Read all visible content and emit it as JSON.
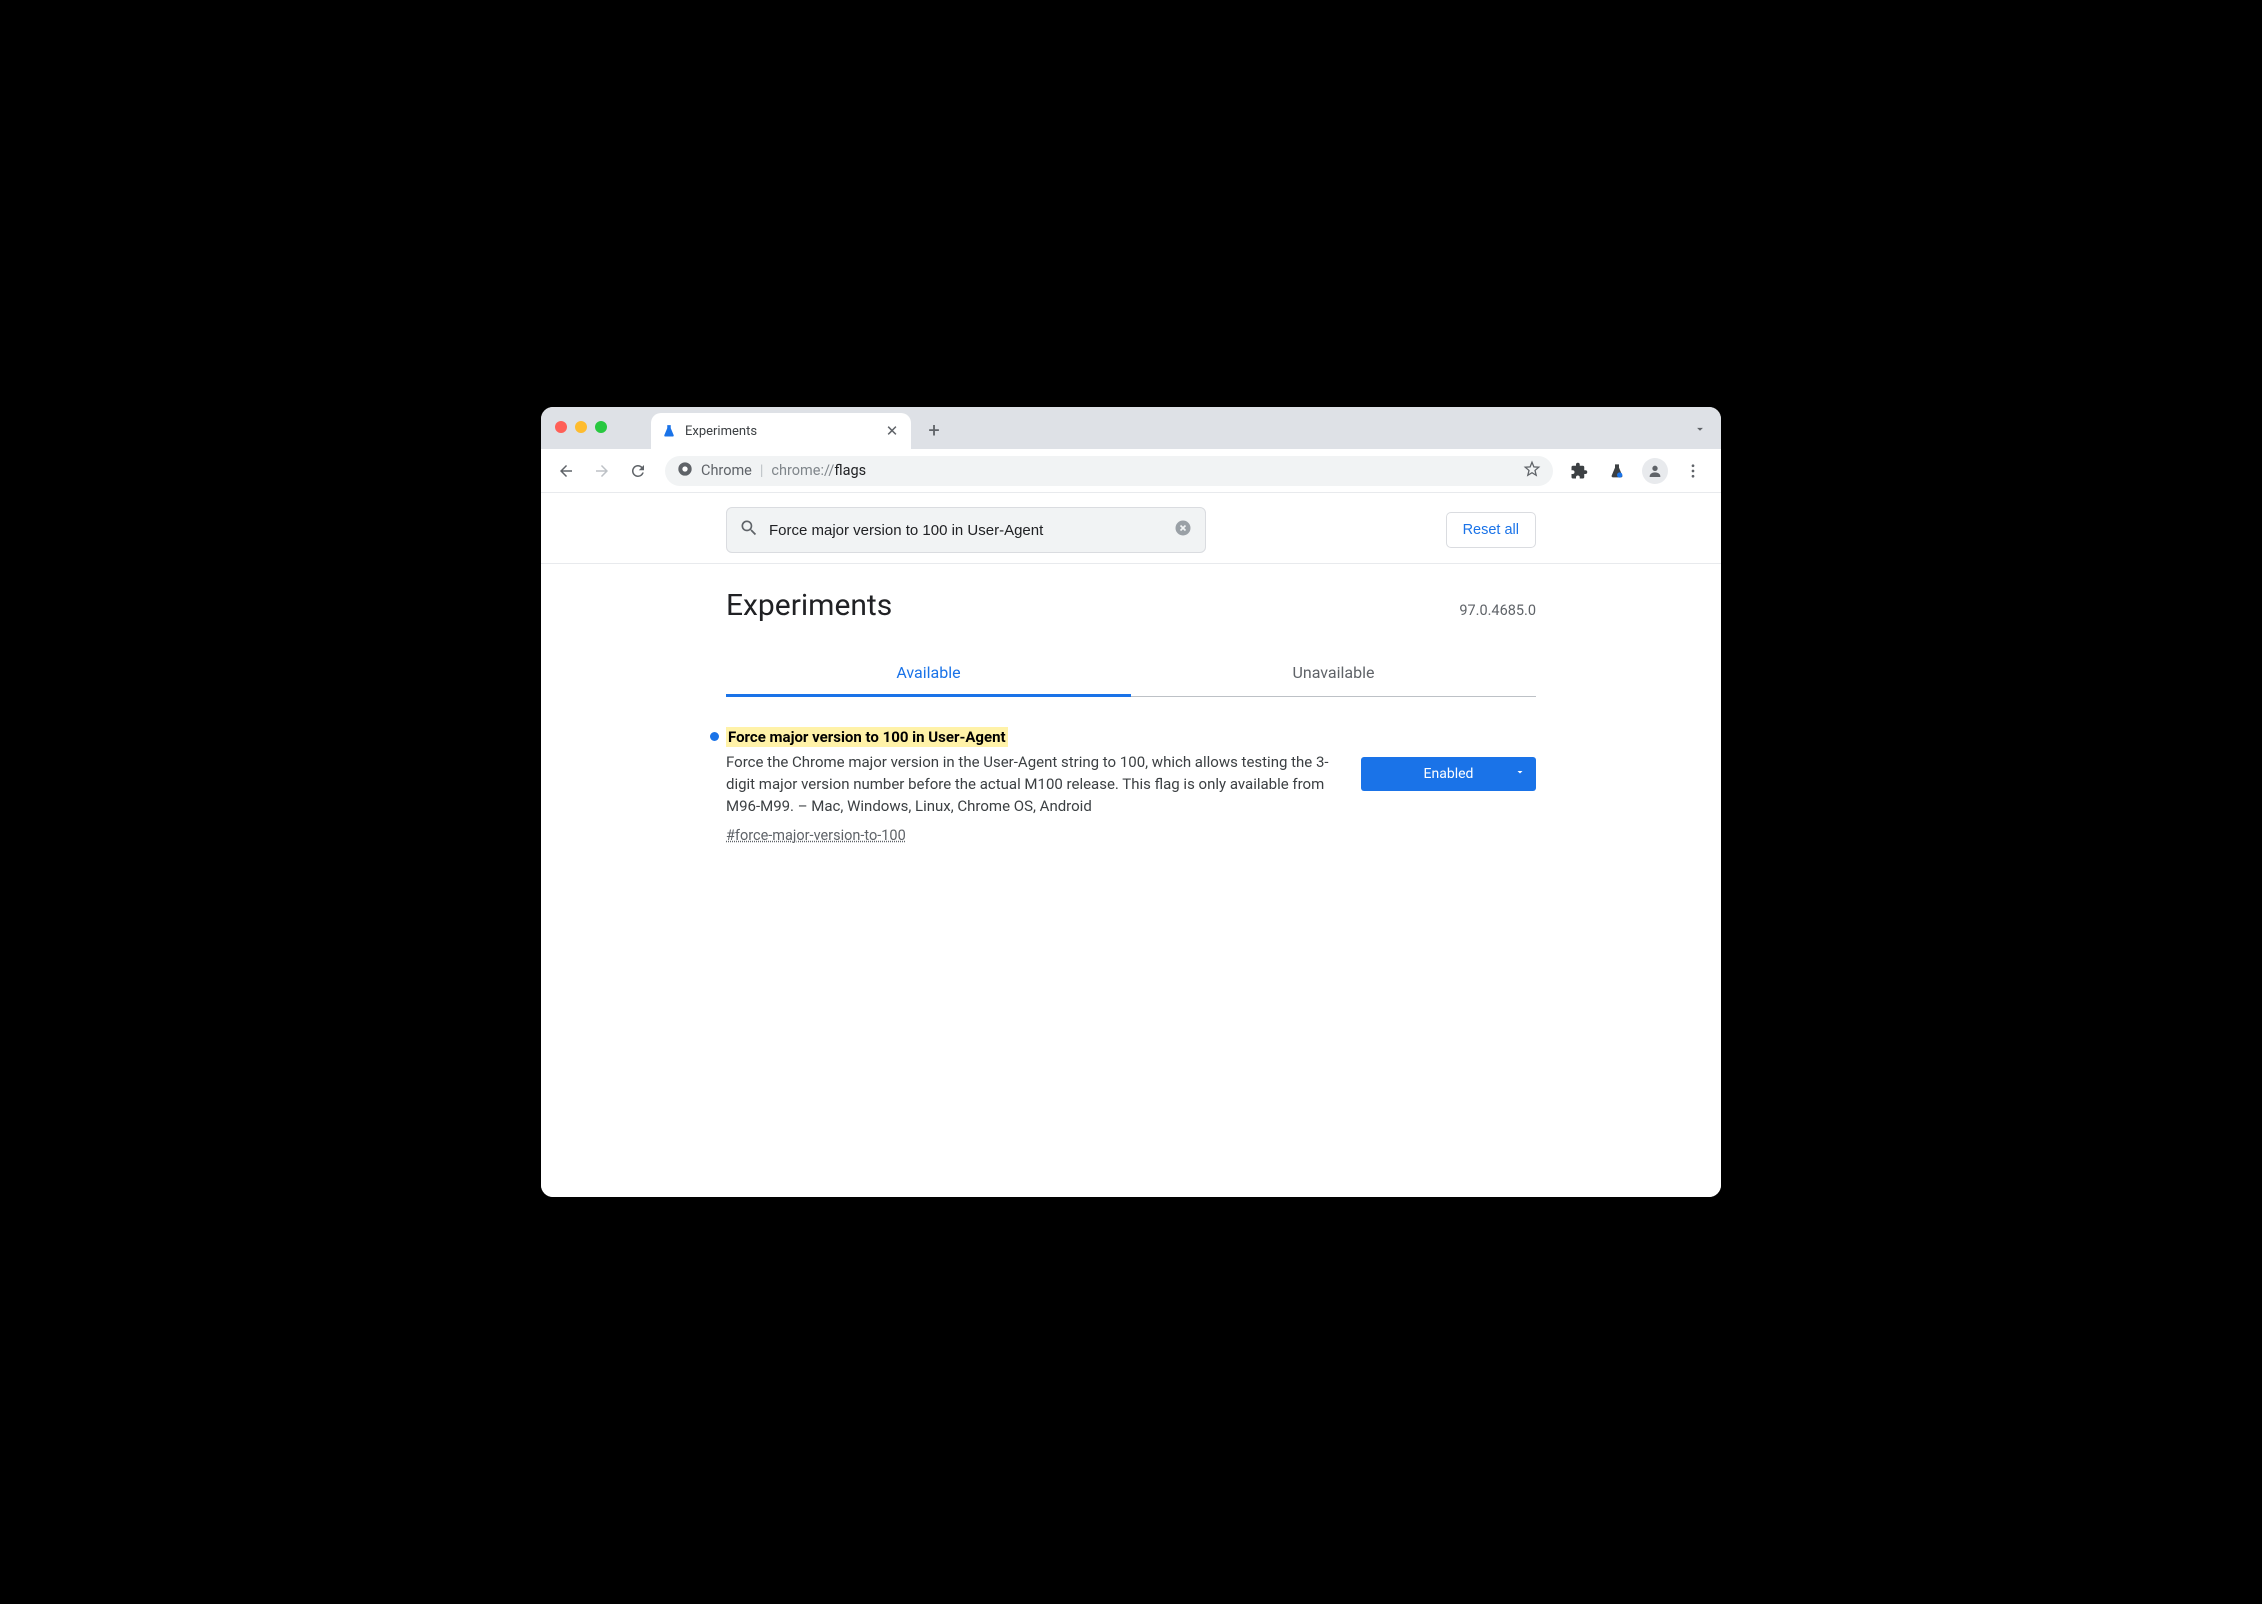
{
  "window": {
    "tab_title": "Experiments"
  },
  "toolbar": {
    "site_label": "Chrome",
    "url_scheme": "chrome://",
    "url_path": "flags"
  },
  "search": {
    "value": "Force major version to 100 in User-Agent",
    "reset_label": "Reset all"
  },
  "header": {
    "title": "Experiments",
    "version": "97.0.4685.0"
  },
  "tabs": {
    "available": "Available",
    "unavailable": "Unavailable"
  },
  "flag": {
    "title": "Force major version to 100 in User-Agent",
    "description": "Force the Chrome major version in the User-Agent string to 100, which allows testing the 3-digit major version number before the actual M100 release. This flag is only available from M96-M99. – Mac, Windows, Linux, Chrome OS, Android",
    "anchor": "#force-major-version-to-100",
    "state": "Enabled"
  }
}
